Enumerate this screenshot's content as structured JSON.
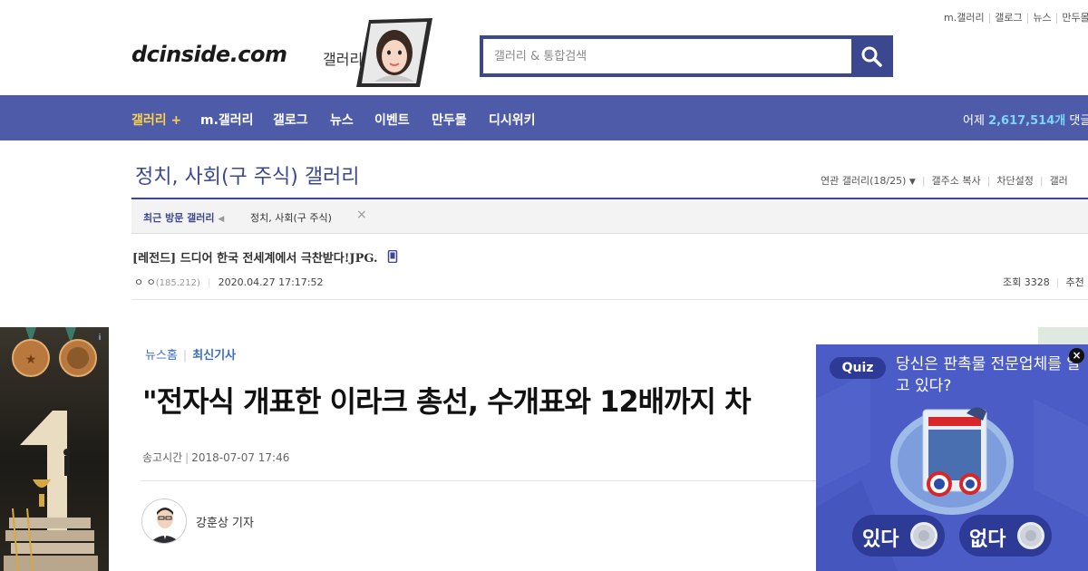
{
  "top_links": [
    "m.갤러리",
    "갤로그",
    "뉴스",
    "만두몰"
  ],
  "logo": {
    "text": "dcinside.com",
    "sub": "갤러리"
  },
  "search": {
    "placeholder": "갤러리 & 통합검색"
  },
  "nav": {
    "items": [
      "갤러리 +",
      "m.갤러리",
      "갤로그",
      "뉴스",
      "이벤트",
      "만두몰",
      "디시위키"
    ],
    "stats_prefix": "어제",
    "stats_value": "2,617,514개",
    "stats_suffix": "댓글"
  },
  "gallery": {
    "title": "정치, 사회(구 주식) 갤러리",
    "tools": [
      "연관 갤러리(18/25)",
      "갤주소 복사",
      "차단설정",
      "갤러"
    ]
  },
  "recent": {
    "label": "최근 방문 갤러리",
    "item": "정치, 사회(구 주식)"
  },
  "post": {
    "title": "[레전드] 드디어 한국 전세계에서 극찬받다!JPG.",
    "author": "ㅇ ㅇ",
    "ip": "(185.212)",
    "date": "2020.04.27 17:17:52",
    "views": "조회 3328",
    "recommend": "추천"
  },
  "article": {
    "crumb_home": "뉴스홈",
    "crumb_current": "최신기사",
    "title": "\"전자식 개표한 이라크 총선, 수개표와 12배까지 차",
    "time_label": "송고시간",
    "time_value": "2018-07-07 17:46",
    "reporter": "강훈상 기자"
  },
  "quiz": {
    "tag": "Quiz",
    "question": "당신은 판촉물 전문업체를 알고 있다?",
    "yes": "있다",
    "no": "없다"
  },
  "colors": {
    "brand": "#3b4890",
    "nav": "#4e5ba8",
    "quiz": "#4c5cc6",
    "link": "#3b6bc8"
  }
}
